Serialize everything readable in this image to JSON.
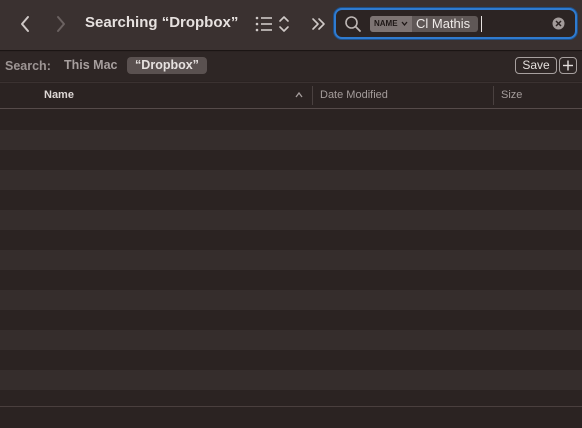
{
  "window": {
    "title": "Searching “Dropbox”"
  },
  "toolbar": {
    "back_icon": "chevron-left-icon",
    "forward_icon": "chevron-right-icon",
    "view_icon": "list-view-icon",
    "more_icon": "double-chevron-icon"
  },
  "search": {
    "token_key": "NAME",
    "token_value": "Cl Mathis",
    "query": ""
  },
  "scope": {
    "label": "Search:",
    "options": [
      "This Mac",
      "“Dropbox”"
    ],
    "selected": "“Dropbox”",
    "save_label": "Save"
  },
  "columns": {
    "name": "Name",
    "date_modified": "Date Modified",
    "size": "Size"
  },
  "colors": {
    "accent": "#2f7bd0",
    "background": "#2b2322",
    "row_alt": "#352d2c"
  },
  "results": []
}
